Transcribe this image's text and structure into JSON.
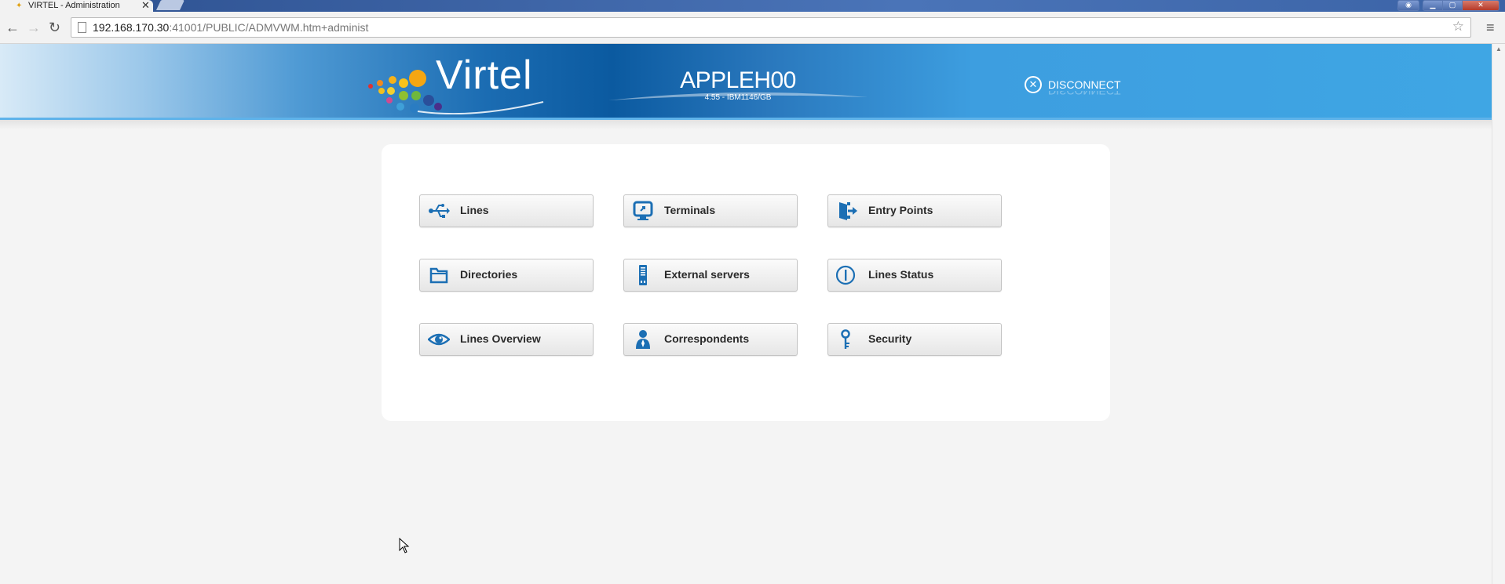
{
  "browser": {
    "tab_title": "VIRTEL - Administration",
    "tab_close": "✕",
    "url_host": "192.168.170.30",
    "url_rest": ":41001/PUBLIC/ADMVWM.htm+administ"
  },
  "header": {
    "logo_text": "Virtel",
    "server_name": "APPLEH00",
    "server_sub": "4.55 - IBM1146/GB",
    "disconnect_label": "DISCONNECT"
  },
  "menu": {
    "lines": "Lines",
    "terminals": "Terminals",
    "entry_points": "Entry Points",
    "directories": "Directories",
    "external_servers": "External servers",
    "lines_status": "Lines Status",
    "lines_overview": "Lines Overview",
    "correspondents": "Correspondents",
    "security": "Security"
  },
  "colors": {
    "icon_blue": "#1c6fb4",
    "header_blue": "#0b5aa0",
    "panel_bg": "#ffffff",
    "page_bg": "#f4f4f4"
  }
}
